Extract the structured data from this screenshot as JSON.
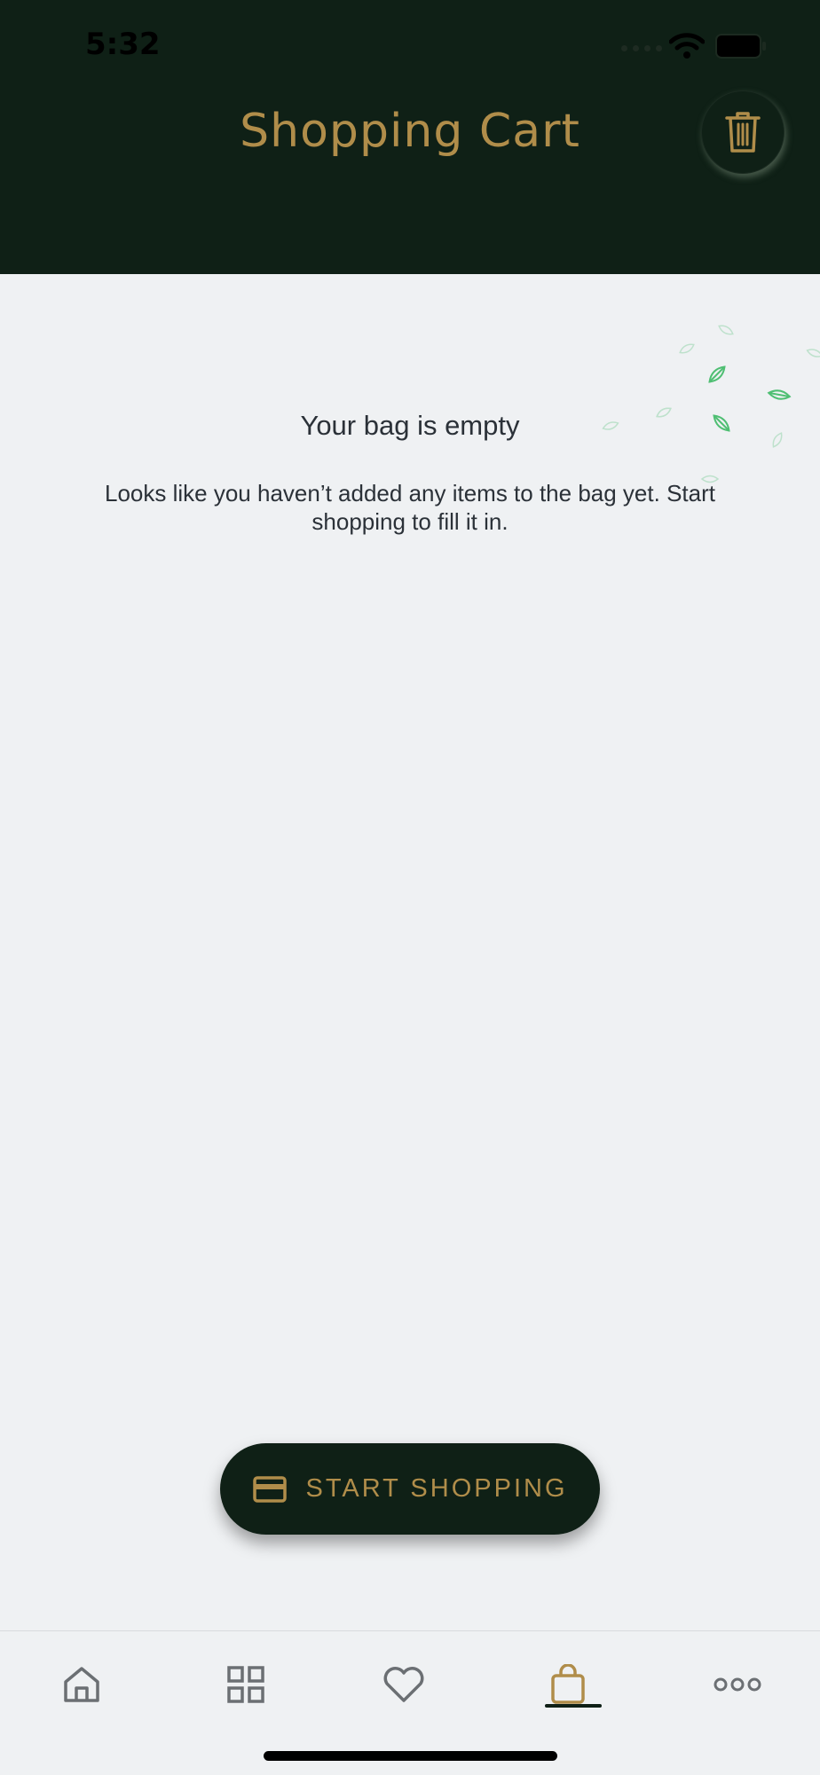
{
  "status_bar": {
    "time": "5:32"
  },
  "header": {
    "title": "Shopping Cart"
  },
  "empty_state": {
    "title": "Your bag is empty",
    "description": "Looks like you haven’t added any items to the bag yet. Start shopping to fill it in."
  },
  "cta": {
    "label": "START SHOPPING",
    "icon": "credit-card-icon"
  },
  "tabs": [
    {
      "icon": "home-icon",
      "active": false
    },
    {
      "icon": "grid-icon",
      "active": false
    },
    {
      "icon": "heart-icon",
      "active": false
    },
    {
      "icon": "shopping-bag-icon",
      "active": true
    },
    {
      "icon": "more-icon",
      "active": false
    }
  ],
  "colors": {
    "header_bg": "#0f2016",
    "accent_gold": "#b08d4a",
    "page_bg": "#eff1f3",
    "text": "#2b3138",
    "leaf_green": "#4fbf73",
    "tab_icon": "#6b6f73"
  }
}
